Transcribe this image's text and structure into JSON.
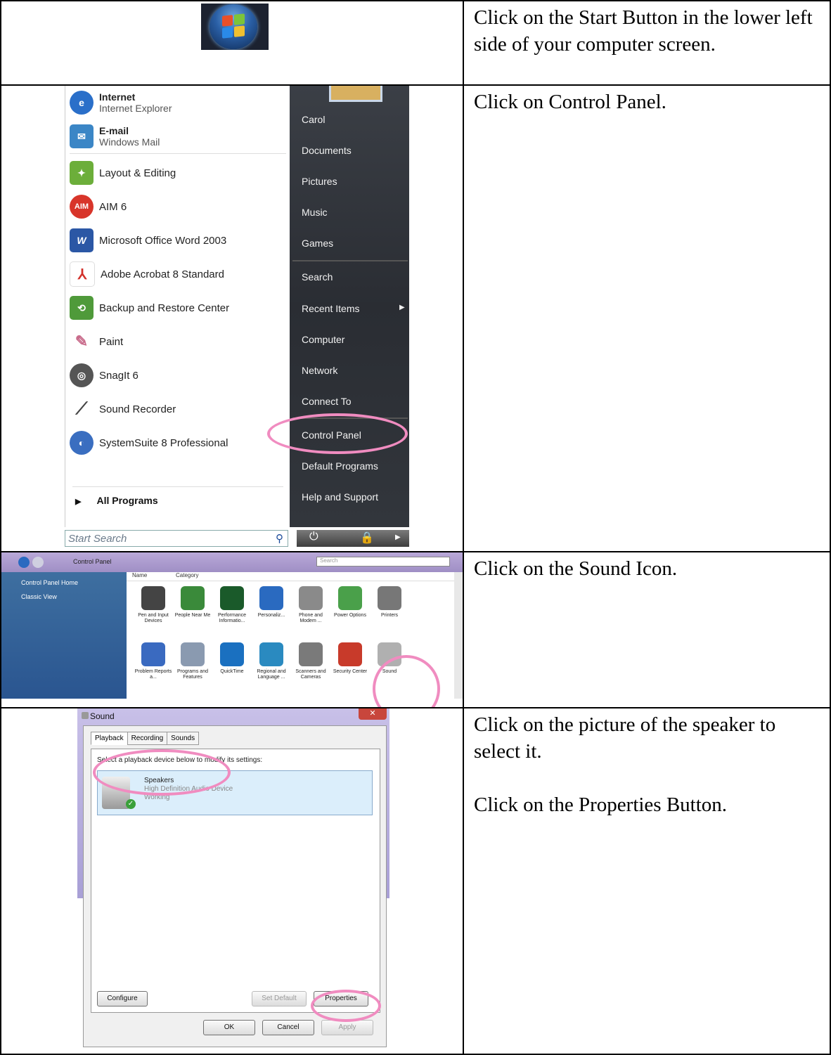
{
  "rows": [
    {
      "instructions": [
        "Click on the Start Button in the lower left side of your computer screen."
      ]
    },
    {
      "instructions": [
        "Click on Control Panel."
      ]
    },
    {
      "instructions": [
        "Click on the Sound Icon."
      ]
    },
    {
      "instructions": [
        "Click on the picture of the speaker to select it.",
        "Click on the Properties Button."
      ]
    }
  ],
  "start_menu": {
    "left_items": [
      {
        "title": "Internet",
        "subtitle": "Internet Explorer",
        "icon": "internet-explorer-icon",
        "color": "#2a6fc9"
      },
      {
        "title": "E-mail",
        "subtitle": "Windows Mail",
        "icon": "mail-icon",
        "color": "#3b86c6"
      },
      {
        "title": "Layout & Editing",
        "icon": "layout-editing-icon",
        "color": "#6cae3a"
      },
      {
        "title": "AIM 6",
        "icon": "aim-icon",
        "color": "#d8352a"
      },
      {
        "title": "Microsoft Office Word 2003",
        "icon": "word-icon",
        "color": "#2b57a5"
      },
      {
        "title": "Adobe Acrobat 8 Standard",
        "icon": "acrobat-icon",
        "color": "#d2302a"
      },
      {
        "title": "Backup and Restore Center",
        "icon": "backup-icon",
        "color": "#4f9a3a"
      },
      {
        "title": "Paint",
        "icon": "paint-icon",
        "color": "#c86a8a"
      },
      {
        "title": "SnagIt 6",
        "icon": "snagit-icon",
        "color": "#555555"
      },
      {
        "title": "Sound Recorder",
        "icon": "microphone-icon",
        "color": "#444444"
      },
      {
        "title": "SystemSuite 8 Professional",
        "icon": "systemsuite-icon",
        "color": "#3a6ec0"
      }
    ],
    "all_programs": "All Programs",
    "search_placeholder": "Start Search",
    "right_items": [
      "Carol",
      "Documents",
      "Pictures",
      "Music",
      "Games",
      "Search",
      "Recent Items",
      "Computer",
      "Network",
      "Connect To",
      "Control Panel",
      "Default Programs",
      "Help and Support"
    ]
  },
  "control_panel": {
    "address": "Control Panel",
    "search_placeholder": "Search",
    "nav": [
      "Control Panel Home",
      "Classic View"
    ],
    "columns": [
      "Name",
      "Category"
    ],
    "icons_row1": [
      {
        "label": "Pen and Input Devices",
        "color": "#444444"
      },
      {
        "label": "People Near Me",
        "color": "#3a8a3a"
      },
      {
        "label": "Performance Informatio...",
        "color": "#1a5a2a"
      },
      {
        "label": "Personaliz...",
        "color": "#2a6ac0"
      },
      {
        "label": "Phone and Modem ...",
        "color": "#8a8a8a"
      },
      {
        "label": "Power Options",
        "color": "#4aa04a"
      },
      {
        "label": "Printers",
        "color": "#777777"
      }
    ],
    "icons_row2": [
      {
        "label": "Problem Reports a...",
        "color": "#3a6ac0"
      },
      {
        "label": "Programs and Features",
        "color": "#8a9ab0"
      },
      {
        "label": "QuickTime",
        "color": "#1a70c0"
      },
      {
        "label": "Regional and Language ...",
        "color": "#2a8ac0"
      },
      {
        "label": "Scanners and Cameras",
        "color": "#7a7a7a"
      },
      {
        "label": "Security Center",
        "color": "#c83a2a"
      },
      {
        "label": "Sound",
        "color": "#b0b0b0"
      }
    ]
  },
  "sound_dialog": {
    "title": "Sound",
    "tabs": [
      "Playback",
      "Recording",
      "Sounds"
    ],
    "instruction": "Select a playback device below to modify its settings:",
    "device_name": "Speakers",
    "device_desc": "High Definition Audio Device",
    "device_status": "Working",
    "configure": "Configure",
    "set_default": "Set Default",
    "properties": "Properties",
    "ok": "OK",
    "cancel": "Cancel",
    "apply": "Apply"
  }
}
